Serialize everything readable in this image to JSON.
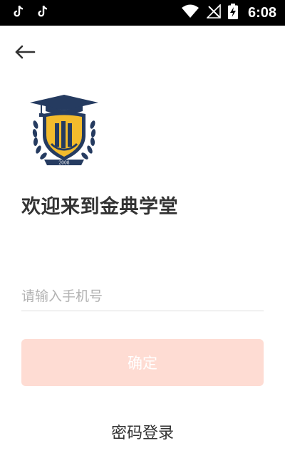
{
  "status_bar": {
    "time": "6:08",
    "left_icons": [
      "tiktok-icon",
      "tiktok-icon"
    ],
    "right_icons": [
      "wifi-icon",
      "no-signal-icon",
      "battery-charging-icon"
    ]
  },
  "header": {
    "back_icon": "arrow-left-icon"
  },
  "logo": {
    "year_text": "2008",
    "icon": "school-shield-logo",
    "colors": {
      "navy": "#253b60",
      "gold": "#f3bb2c"
    }
  },
  "main": {
    "title": "欢迎来到金典学堂",
    "phone_input": {
      "placeholder": "请输入手机号",
      "value": ""
    },
    "confirm_button": "确定",
    "password_login_link": "密码登录"
  },
  "colors": {
    "button_bg": "#fedcd3",
    "button_text": "#ffffff",
    "text_primary": "#333333",
    "placeholder": "#b3b3b3"
  }
}
